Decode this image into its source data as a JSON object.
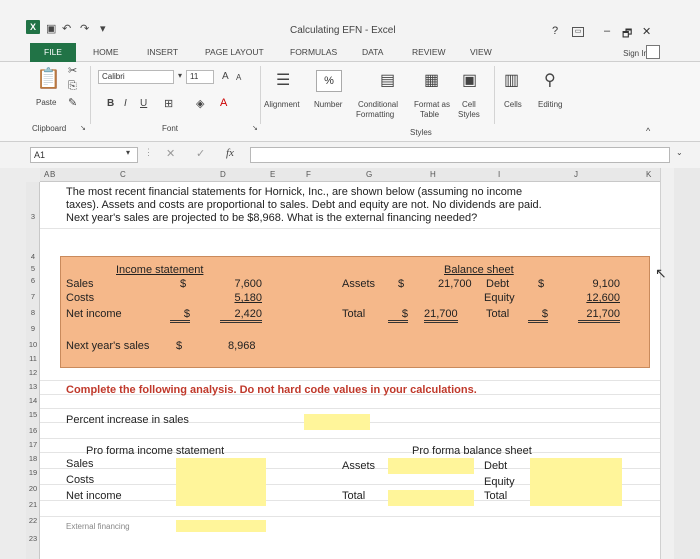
{
  "window": {
    "title": "Calculating EFN - Excel",
    "help": "?",
    "min": "–",
    "max": "🗗",
    "close": "✕"
  },
  "tabs": [
    "FILE",
    "HOME",
    "INSERT",
    "PAGE LAYOUT",
    "FORMULAS",
    "DATA",
    "REVIEW",
    "VIEW"
  ],
  "signin": "Sign In",
  "ribbon": {
    "paste": "Paste",
    "font_name": "Calibri",
    "font_size": "11",
    "grow": "A",
    "shrink": "A",
    "bold": "B",
    "italic": "I",
    "underline": "U",
    "alignment": "Alignment",
    "number": "Number",
    "number_icon": "%",
    "conditional": "Conditional",
    "formatting": "Formatting",
    "format_as": "Format as",
    "table": "Table",
    "cell": "Cell",
    "styles_btn": "Styles",
    "cells": "Cells",
    "editing": "Editing",
    "clipboard_group": "Clipboard",
    "font_group": "Font",
    "styles_group": "Styles"
  },
  "formula": {
    "namebox": "A1",
    "fx": "fx",
    "cancel": "✕",
    "enter": "✓"
  },
  "columns": [
    "A",
    "B",
    "C",
    "D",
    "E",
    "F",
    "G",
    "H",
    "I",
    "J",
    "K"
  ],
  "rows": [
    "3",
    "4",
    "5",
    "6",
    "7",
    "8",
    "9",
    "10",
    "11",
    "12",
    "13",
    "14",
    "15",
    "16",
    "17",
    "18",
    "19",
    "20",
    "21",
    "22",
    "23"
  ],
  "problem": {
    "line1": "The most recent financial statements for Hornick, Inc., are shown below (assuming no income",
    "line2": "taxes). Assets and costs are proportional to sales. Debt and equity are not. No dividends are paid.",
    "line3": "Next year's sales are projected to be $8,968. What is the external financing needed?"
  },
  "income_statement": {
    "title": "Income statement",
    "rows": [
      {
        "label": "Sales",
        "currency": "$",
        "value": "7,600"
      },
      {
        "label": "Costs",
        "currency": "",
        "value": "5,180"
      },
      {
        "label": "Net income",
        "currency": "$",
        "value": "2,420"
      }
    ]
  },
  "balance_sheet": {
    "title": "Balance sheet",
    "assets_label": "Assets",
    "assets_currency": "$",
    "assets_value": "21,700",
    "debt_label": "Debt",
    "debt_currency": "$",
    "debt_value": "9,100",
    "equity_label": "Equity",
    "equity_value": "12,600",
    "total_label": "Total",
    "total_currency": "$",
    "total_value": "21,700",
    "total2_label": "Total",
    "total2_currency": "$",
    "total2_value": "21,700"
  },
  "next_year": {
    "label": "Next year's sales",
    "currency": "$",
    "value": "8,968"
  },
  "instruction": "Complete the following analysis. Do not hard code values in your calculations.",
  "percent_increase": "Percent increase in sales",
  "pro_forma_is": {
    "title": "Pro forma income statement",
    "rows": [
      "Sales",
      "Costs",
      "Net income"
    ]
  },
  "pro_forma_bs": {
    "title": "Pro forma balance sheet",
    "assets": "Assets",
    "total": "Total",
    "debt": "Debt",
    "equity": "Equity",
    "total2": "Total"
  },
  "cutoff_text": "External financing"
}
